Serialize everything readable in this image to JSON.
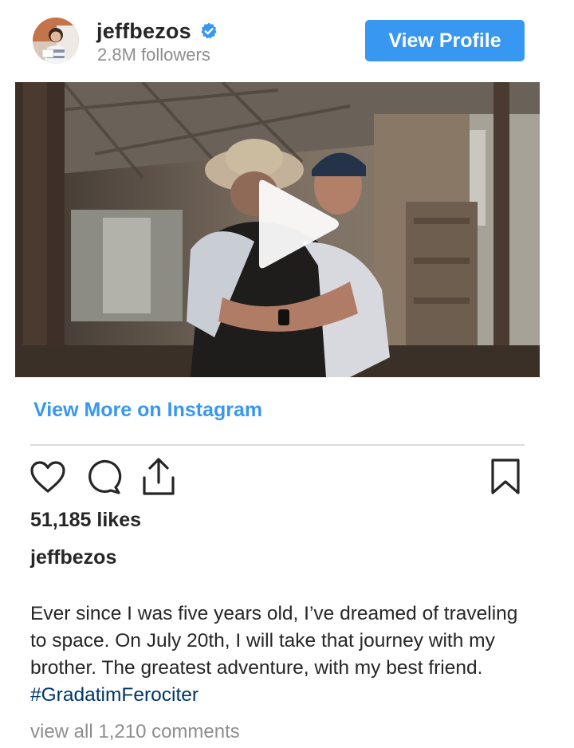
{
  "profile": {
    "username": "jeffbezos",
    "followers": "2.8M followers",
    "view_profile_label": "View Profile"
  },
  "icons": {
    "verified": "verified-badge-icon",
    "play": "play-icon",
    "like": "heart-icon",
    "comment": "comment-bubble-icon",
    "share": "share-icon",
    "save": "bookmark-icon"
  },
  "post": {
    "view_more_label": "View More on Instagram",
    "likes": "51,185 likes",
    "caption_user": "jeffbezos",
    "caption_text": "Ever since I was five years old, I’ve dreamed of traveling to space. On July 20th, I will take that journey with my brother. The greatest adventure, with my best friend. ",
    "hashtag": "#GradatimFerociter",
    "comments_label": "view all 1,210 comments"
  },
  "colors": {
    "accent_blue": "#3897f0",
    "hashtag_blue": "#003569",
    "muted_text": "#8e8e8e",
    "text": "#262626",
    "divider": "#dbdbdb"
  }
}
